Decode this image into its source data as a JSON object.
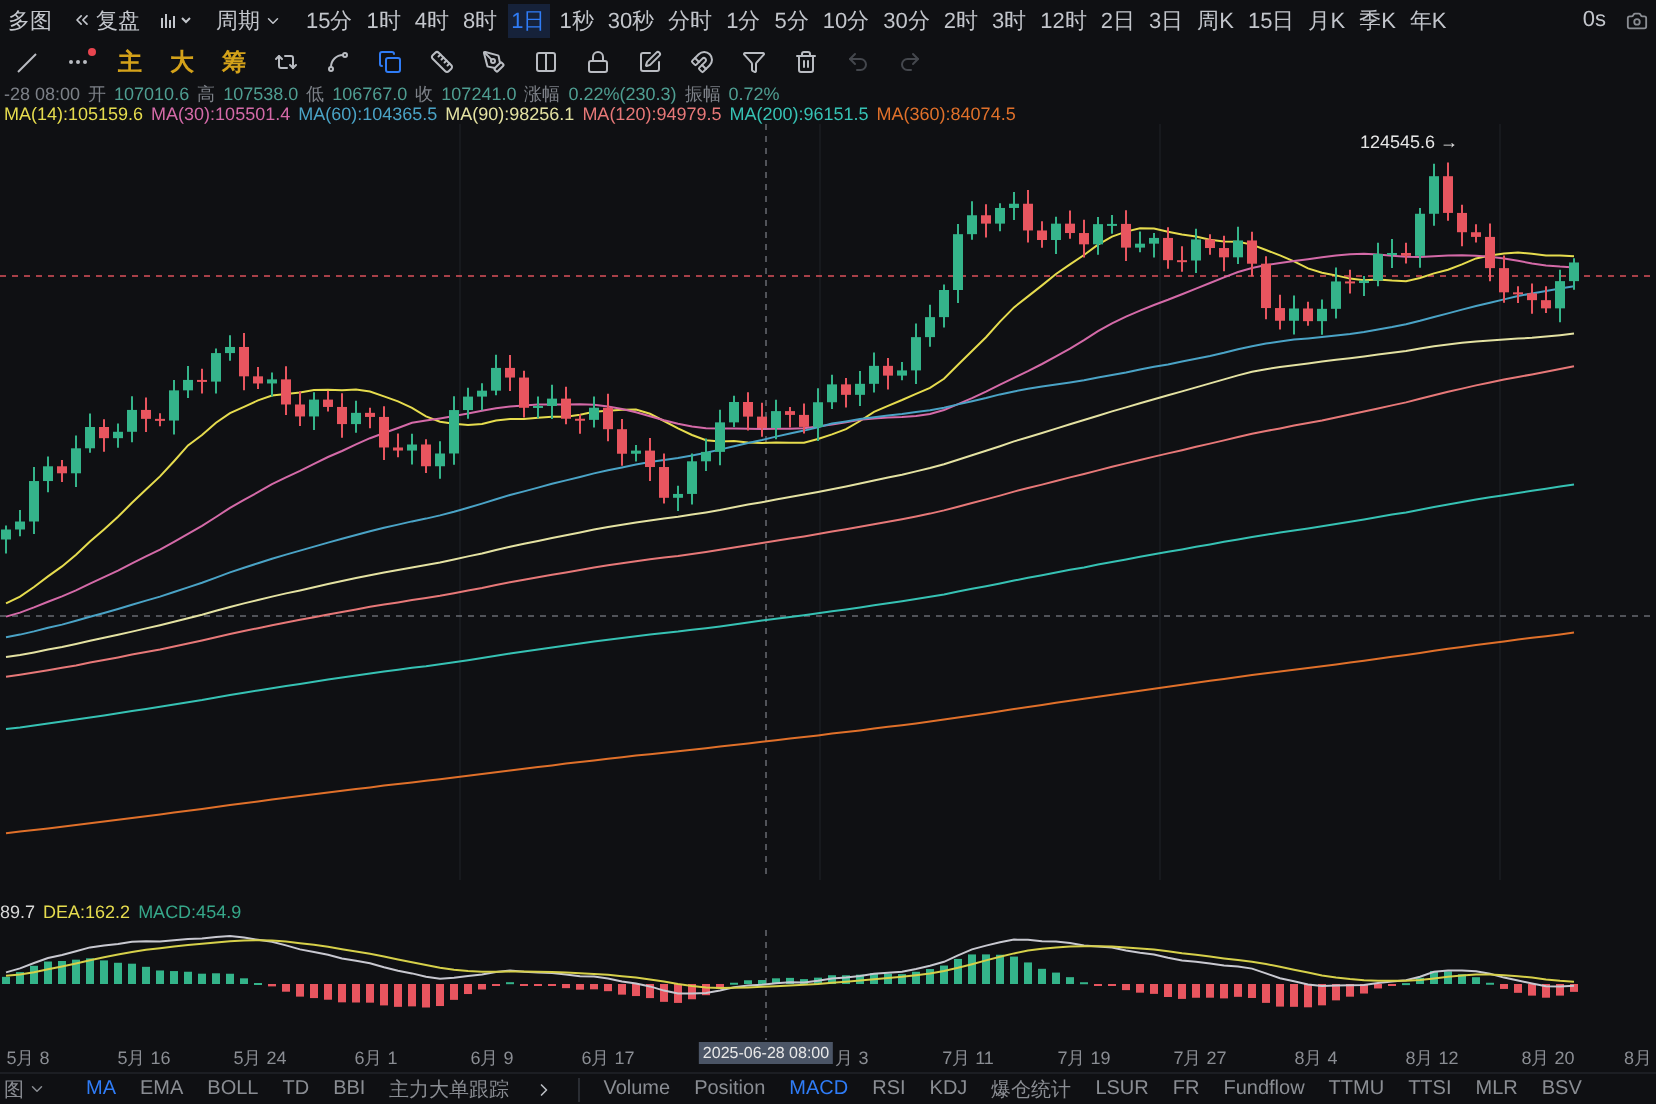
{
  "top_bar": {
    "layout_label": "多图",
    "replay_label": "复盘",
    "period_label": "周期",
    "refresh": "0s",
    "intervals": [
      {
        "label": "15分",
        "selected": false
      },
      {
        "label": "1时",
        "selected": false
      },
      {
        "label": "4时",
        "selected": false
      },
      {
        "label": "8时",
        "selected": false
      },
      {
        "label": "1日",
        "selected": true
      },
      {
        "label": "1秒",
        "selected": false
      },
      {
        "label": "30秒",
        "selected": false
      },
      {
        "label": "分时",
        "selected": false
      },
      {
        "label": "1分",
        "selected": false
      },
      {
        "label": "5分",
        "selected": false
      },
      {
        "label": "10分",
        "selected": false
      },
      {
        "label": "30分",
        "selected": false
      },
      {
        "label": "2时",
        "selected": false
      },
      {
        "label": "3时",
        "selected": false
      },
      {
        "label": "12时",
        "selected": false
      },
      {
        "label": "2日",
        "selected": false
      },
      {
        "label": "3日",
        "selected": false
      },
      {
        "label": "周K",
        "selected": false
      },
      {
        "label": "15日",
        "selected": false
      },
      {
        "label": "月K",
        "selected": false
      },
      {
        "label": "季K",
        "selected": false
      },
      {
        "label": "年K",
        "selected": false
      }
    ]
  },
  "tools": {
    "labels": [
      "主",
      "大",
      "筹"
    ]
  },
  "ohlc": {
    "time": "-28 08:00",
    "fields": [
      {
        "label": "开",
        "value": "107010.6"
      },
      {
        "label": "高",
        "value": "107538.0"
      },
      {
        "label": "低",
        "value": "106767.0"
      },
      {
        "label": "收",
        "value": "107241.0"
      },
      {
        "label": "涨幅",
        "value": "0.22%(230.3)"
      },
      {
        "label": "振幅",
        "value": "0.72%"
      }
    ]
  },
  "ma_legend": [
    {
      "label": "MA(14):105159.6",
      "color": "#e6dc4e"
    },
    {
      "label": "MA(30):105501.4",
      "color": "#d46aa8"
    },
    {
      "label": "MA(60):104365.5",
      "color": "#4aa3c6"
    },
    {
      "label": "MA(90):98256.1",
      "color": "#e4e2a2"
    },
    {
      "label": "MA(120):94979.5",
      "color": "#e77878"
    },
    {
      "label": "MA(200):96151.5",
      "color": "#36c2b4"
    },
    {
      "label": "MA(360):84074.5",
      "color": "#e0702a"
    }
  ],
  "chart": {
    "high_label": "124545.6 →"
  },
  "macd": {
    "labels": [
      {
        "label": "89.7",
        "color": "#d8d8d8"
      },
      {
        "label": "DEA:162.2",
        "color": "#e6dc4e"
      },
      {
        "label": "MACD:454.9",
        "color": "#36a88a"
      }
    ]
  },
  "x_axis": {
    "labels": [
      "5月 8",
      "5月 16",
      "5月 24",
      "6月 1",
      "6月 9",
      "6月 17",
      "月 3",
      "7月 11",
      "7月 19",
      "7月 27",
      "8月 4",
      "8月 12",
      "8月 20",
      "8月"
    ],
    "crosshair_label": "2025-06-28 08:00"
  },
  "indicator_tabs": {
    "menu_label": "图",
    "main": [
      {
        "label": "MA",
        "selected": true
      },
      {
        "label": "EMA",
        "selected": false
      },
      {
        "label": "BOLL",
        "selected": false
      },
      {
        "label": "TD",
        "selected": false
      },
      {
        "label": "BBI",
        "selected": false
      },
      {
        "label": "主力大单跟踪",
        "selected": false
      }
    ],
    "sub": [
      {
        "label": "Volume",
        "selected": false
      },
      {
        "label": "Position",
        "selected": false
      },
      {
        "label": "MACD",
        "selected": true
      },
      {
        "label": "RSI",
        "selected": false
      },
      {
        "label": "KDJ",
        "selected": false
      },
      {
        "label": "爆仓统计",
        "selected": false
      },
      {
        "label": "LSUR",
        "selected": false
      },
      {
        "label": "FR",
        "selected": false
      },
      {
        "label": "Fundflow",
        "selected": false
      },
      {
        "label": "TTMU",
        "selected": false
      },
      {
        "label": "TTSI",
        "selected": false
      },
      {
        "label": "MLR",
        "selected": false
      },
      {
        "label": "BSV",
        "selected": false
      }
    ]
  }
}
